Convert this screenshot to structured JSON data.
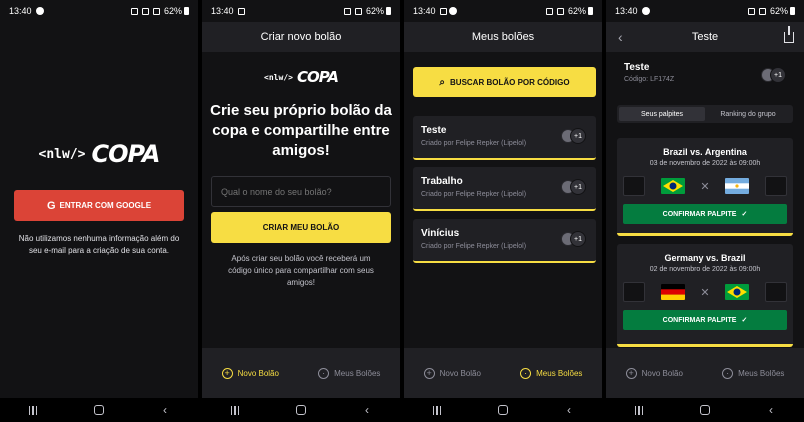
{
  "status": {
    "time": "13:40",
    "battery": "62%"
  },
  "screen1": {
    "logo_bracket": "<nlw/>",
    "logo_word": "COPA",
    "google_button": "ENTRAR COM GOOGLE",
    "google_icon": "G",
    "disclaimer": "Não utilizamos nenhuma informação além do seu e-mail para a criação de sua conta."
  },
  "screen2": {
    "title": "Criar novo bolão",
    "logo_bracket": "<nlw/>",
    "logo_word": "COPA",
    "heading": "Crie seu próprio bolão da copa e compartilhe entre amigos!",
    "input_placeholder": "Qual o nome do seu bolão?",
    "create_button": "CRIAR MEU BOLÃO",
    "info": "Após criar seu bolão você receberá um código único para compartilhar com seus amigos!"
  },
  "screen3": {
    "title": "Meus bolões",
    "search_button": "BUSCAR BOLÃO POR CÓDIGO",
    "pools": [
      {
        "name": "Teste",
        "creator": "Criado por Felipe Repker (Lipelol)",
        "extra": "+1"
      },
      {
        "name": "Trabalho",
        "creator": "Criado por Felipe Repker (Lipelol)",
        "extra": "+1"
      },
      {
        "name": "Vinícius",
        "creator": "Criado por Felipe Repker (Lipelol)",
        "extra": "+1"
      }
    ]
  },
  "screen4": {
    "title": "Teste",
    "pool_name": "Teste",
    "pool_code": "Código: LF174Z",
    "extra": "+1",
    "tabs": [
      "Seus palpites",
      "Ranking do grupo"
    ],
    "games": [
      {
        "title": "Brazil vs. Argentina",
        "date": "03 de novembro de 2022 às 09:00h",
        "confirm": "CONFIRMAR PALPITE",
        "flag_left": "brazil",
        "flag_right": "argentina"
      },
      {
        "title": "Germany vs. Brazil",
        "date": "02 de novembro de 2022 às 09:00h",
        "confirm": "CONFIRMAR PALPITE",
        "flag_left": "germany",
        "flag_right": "brazil"
      }
    ]
  },
  "tabbar": {
    "new_pool": "Novo Bolão",
    "my_pools": "Meus Bolões"
  },
  "colors": {
    "yellow": "#F7DD43",
    "google_red": "#DB4437",
    "green": "#047C3F",
    "background": "#121214",
    "surface": "#202024"
  }
}
